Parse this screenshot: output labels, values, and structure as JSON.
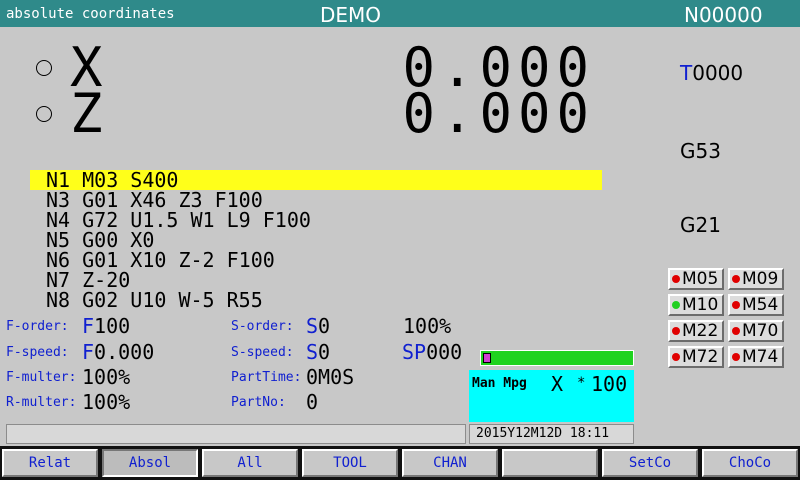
{
  "header": {
    "mode": "absolute coordinates",
    "program": "DEMO",
    "sequence": "N00000"
  },
  "axes": [
    {
      "name": "X",
      "value": "0.000"
    },
    {
      "name": "Z",
      "value": "0.000"
    }
  ],
  "side": {
    "tool_prefix": "T",
    "tool_number": "0000",
    "coord_system": "G53",
    "unit_mode": "G21"
  },
  "program_lines": [
    "N1 M03 S400",
    "N3 G01 X46 Z3 F100",
    "N4 G72 U1.5 W1 L9 F100",
    "N5 G00 X0",
    "N6 G01 X10 Z-2 F100",
    "N7 Z-20",
    "N8 G02 U10 W-5 R55"
  ],
  "status": {
    "f_order_label": "F-order:",
    "f_order_prefix": "F",
    "f_order_value": "100",
    "f_speed_label": "F-speed:",
    "f_speed_prefix": "F",
    "f_speed_value": "0.000",
    "f_multer_label": "F-multer:",
    "f_multer_value": "100%",
    "r_multer_label": "R-multer:",
    "r_multer_value": "100%",
    "s_order_label": "S-order:",
    "s_order_prefix": "S",
    "s_order_value": "0",
    "s_order_pct": "100%",
    "s_speed_label": "S-speed:",
    "s_speed_prefix": "S",
    "s_speed_value": "0",
    "sp_label": "SP",
    "sp_value": "000",
    "part_time_label": "PartTime:",
    "part_time_value": "0M0S",
    "part_no_label": "PartNo:",
    "part_no_value": "0"
  },
  "mcodes": [
    {
      "label": "M05",
      "led": "#e00000"
    },
    {
      "label": "M09",
      "led": "#e00000"
    },
    {
      "label": "M10",
      "led": "#20d020"
    },
    {
      "label": "M54",
      "led": "#e00000"
    },
    {
      "label": "M22",
      "led": "#e00000"
    },
    {
      "label": "M70",
      "led": "#e00000"
    },
    {
      "label": "M72",
      "led": "#e00000"
    },
    {
      "label": "M74",
      "led": "#e00000"
    }
  ],
  "mpg": {
    "mode": "Man Mpg",
    "axis": "X",
    "times": "*",
    "multiplier": "100"
  },
  "datetime": "2015Y12M12D 18:11",
  "softkeys": [
    "Relat",
    "Absol",
    "All",
    "TOOL",
    "CHAN",
    "",
    "SetCo",
    "ChoCo"
  ],
  "selected_softkey": "Absol"
}
